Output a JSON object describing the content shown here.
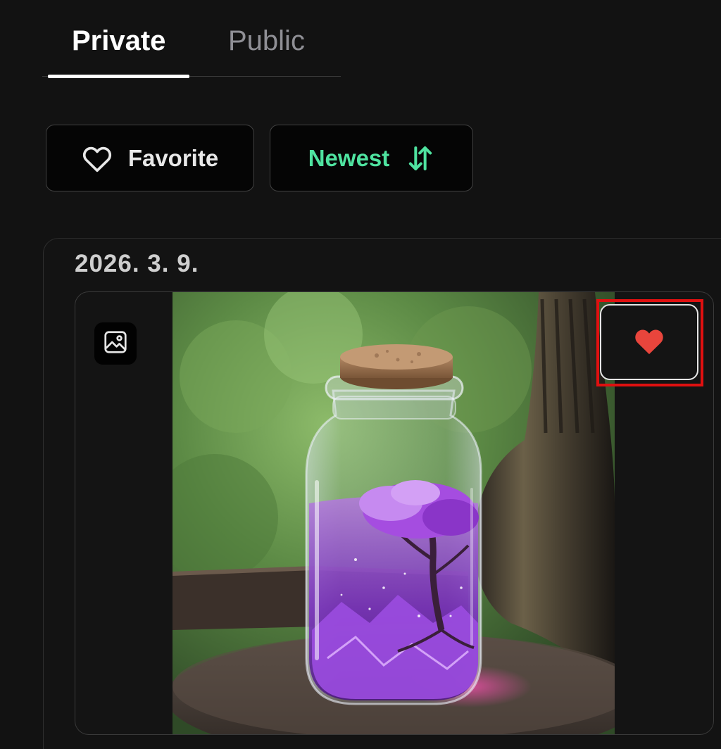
{
  "tabs": {
    "items": [
      {
        "label": "Private",
        "active": true
      },
      {
        "label": "Public",
        "active": false
      }
    ]
  },
  "filters": {
    "favorite_label": "Favorite",
    "favorite_icon": "heart-outline-icon",
    "sort_label": "Newest",
    "sort_icon": "sort-arrows-icon",
    "sort_color": "#4fe3a0"
  },
  "gallery": {
    "date": "2026. 3. 9.",
    "items": [
      {
        "type_icon": "image-icon",
        "favorited": true,
        "heart_color": "#e8453c"
      }
    ]
  },
  "highlight_color": "#e01010"
}
